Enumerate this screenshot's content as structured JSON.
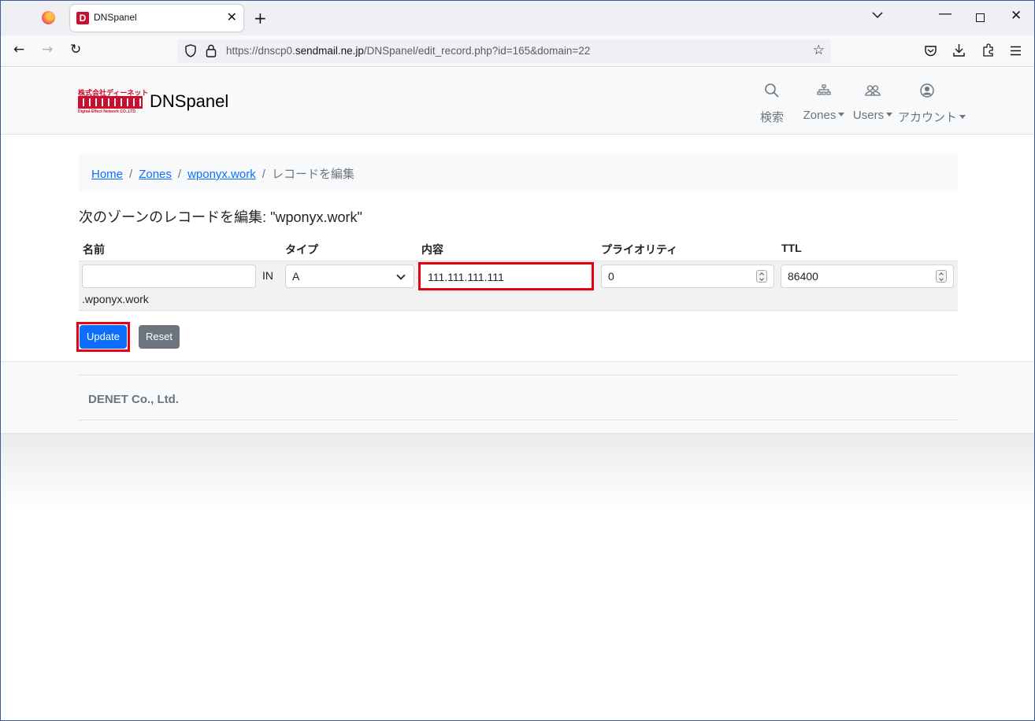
{
  "browser": {
    "tab_title": "DNSpanel",
    "tab_favicon": "D",
    "url_prefix": "https://dnscp0.",
    "url_domain": "sendmail.ne.jp",
    "url_path": "/DNSpanel/edit_record.php?id=165&domain=22"
  },
  "header": {
    "brand": "DNSpanel",
    "logo_top": "株式会社ディーネット",
    "logo_sub": "Digital-Effect Network CO.,LTD.",
    "nav": {
      "search": "検索",
      "zones": "Zones",
      "users": "Users",
      "account": "アカウント"
    }
  },
  "breadcrumb": {
    "home": "Home",
    "zones": "Zones",
    "domain": "wponyx.work",
    "current": "レコードを編集"
  },
  "page": {
    "title": "次のゾーンのレコードを編集: \"wponyx.work\""
  },
  "table": {
    "headers": {
      "name": "名前",
      "type": "タイプ",
      "content": "内容",
      "priority": "プライオリティ",
      "ttl": "TTL"
    },
    "row": {
      "name_value": "",
      "in_label": "IN",
      "type_value": "A",
      "content_value": "111.111.111.111",
      "priority_value": "0",
      "ttl_value": "86400",
      "domain_suffix": ".wponyx.work"
    }
  },
  "buttons": {
    "update": "Update",
    "reset": "Reset"
  },
  "footer": {
    "company": "DENET Co., Ltd."
  },
  "colors": {
    "primary": "#0d6efd",
    "secondary": "#6c757d",
    "highlight": "#e60012",
    "brand_red": "#c8102e"
  }
}
